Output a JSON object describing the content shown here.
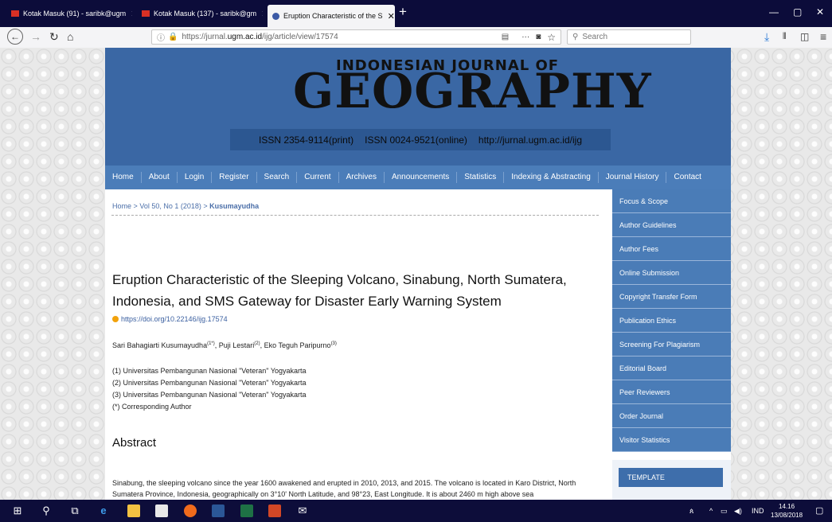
{
  "browser": {
    "tabs": [
      {
        "label": "Kotak Masuk (91) - saribk@ugm",
        "active": false
      },
      {
        "label": "Kotak Masuk (137) - saribk@gm",
        "active": false
      },
      {
        "label": "Eruption Characteristic of the S",
        "active": true
      }
    ],
    "close_glyph": "✕",
    "new_tab_glyph": "+",
    "url_prefix": "https://jurnal.",
    "url_host": "ugm.ac.id",
    "url_rest": "/ijg/article/view/17574",
    "search_placeholder": "Search",
    "reader_glyph": "▤",
    "more_glyph": "···",
    "pocket_glyph": "◙",
    "star_glyph": "☆",
    "window_controls": {
      "minimize": "—",
      "maximize": "▢",
      "close": "✕"
    }
  },
  "journal": {
    "logo_top": "INDONESIAN JOURNAL OF",
    "logo_main": "GEOGRAPHY",
    "issn_print": "ISSN 2354-9114(print)",
    "issn_online": "ISSN 0024-9521(online)",
    "url": "http://jurnal.ugm.ac.id/ijg"
  },
  "menu": [
    "Home",
    "About",
    "Login",
    "Register",
    "Search",
    "Current",
    "Archives",
    "Announcements",
    "Statistics",
    "Indexing & Abstracting",
    "Journal History",
    "Contact"
  ],
  "breadcrumb": {
    "home": "Home",
    "issue": "Vol 50, No 1 (2018)",
    "current": "Kusumayudha",
    "separator": ">"
  },
  "article": {
    "title": "Eruption Characteristic of the Sleeping Volcano, Sinabung, North Sumatera, Indonesia, and SMS Gateway for Disaster Early Warning System",
    "doi": "https://doi.org/10.22146/ijg.17574",
    "authors": [
      {
        "name": "Sari Bahagiarti Kusumayudha",
        "sup": "(1*)",
        "sep": ", "
      },
      {
        "name": "Puji Lestari",
        "sup": "(2)",
        "sep": ", "
      },
      {
        "name": "Eko Teguh Paripurno",
        "sup": "(3)",
        "sep": ""
      }
    ],
    "affiliations": [
      "(1) Universitas Pembangunan Nasional \"Veteran\" Yogyakarta",
      "(2) Universitas Pembangunan Nasional \"Veteran\" Yogyakarta",
      "(3) Universitas Pembangunan Nasional \"Veteran\" Yogyakarta",
      "(*) Corresponding Author"
    ],
    "abstract_heading": "Abstract",
    "abstract_text": "Sinabung, the sleeping volcano since the year 1600 awakened and erupted in 2010, 2013, and 2015. The volcano is located in Karo District, North Sumatera Province, Indonesia, geographically on 3°10' North Latitude, and 98°23, East Longitude. It is about 2460 m high above sea"
  },
  "sidebar": {
    "items": [
      "Focus & Scope",
      "Author Guidelines",
      "Author Fees",
      "Online Submission",
      "Copyright Transfer Form",
      "Publication Ethics",
      "Screening For Plagiarism",
      "Editorial Board",
      "Peer Reviewers",
      "Order Journal",
      "Visitor Statistics"
    ],
    "template_label": "TEMPLATE"
  },
  "taskbar": {
    "tray_lang": "IND",
    "time": "14.16",
    "date": "13/08/2018"
  }
}
